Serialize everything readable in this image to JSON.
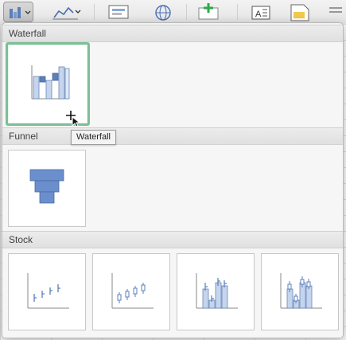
{
  "sections": {
    "waterfall": {
      "title": "Waterfall"
    },
    "funnel": {
      "title": "Funnel"
    },
    "stock": {
      "title": "Stock"
    }
  },
  "tooltip": {
    "text": "Waterfall"
  },
  "colors": {
    "selection_border": "#7dbf96",
    "chart_fill_light": "#c5d5ee",
    "chart_fill_dark": "#5b7fb8",
    "funnel_fill": "#6b8fcd"
  },
  "icons": {
    "chart_type_button": "combo-chart-icon",
    "cursor": "move-cursor-icon"
  }
}
